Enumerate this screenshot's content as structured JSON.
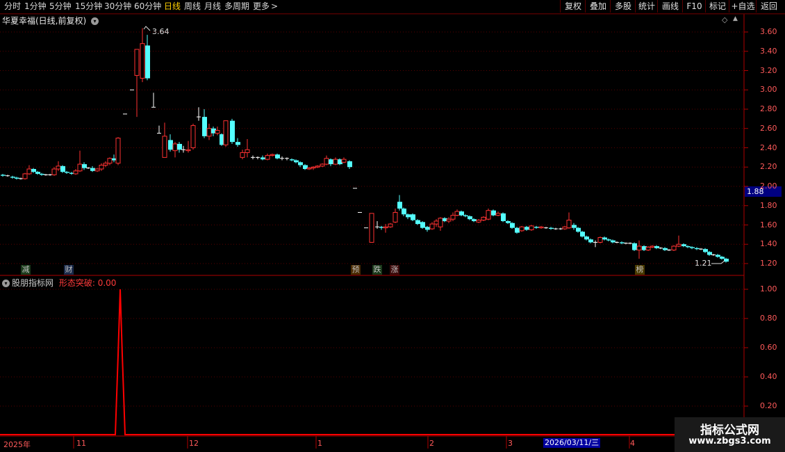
{
  "toolbar": {
    "periods": [
      "分时",
      "1分钟",
      "5分钟",
      "15分钟",
      "30分钟",
      "60分钟",
      "日线",
      "周线",
      "月线",
      "多周期",
      "更多"
    ],
    "active_period": "日线",
    "more_arrow": ">",
    "buttons": [
      "复权",
      "叠加",
      "多股",
      "统计",
      "画线",
      "F10",
      "标记",
      "+自选",
      "返回"
    ]
  },
  "main_panel": {
    "title": "华夏幸福(日线,前复权)",
    "price_axis": [
      "3.60",
      "3.40",
      "3.20",
      "3.00",
      "2.80",
      "2.60",
      "2.40",
      "2.20",
      "2.00",
      "1.80",
      "1.60",
      "1.40",
      "1.20"
    ],
    "current_price": "1.88",
    "high_label": "3.64",
    "low_label": "1.21",
    "events": [
      {
        "text": "减",
        "color": "#22cc22"
      },
      {
        "text": "财",
        "color": "#4aa0ff"
      },
      {
        "text": "预",
        "color": "#ff9a30"
      },
      {
        "text": "跌",
        "color": "#22cc22"
      },
      {
        "text": "涨",
        "color": "#ff4040"
      },
      {
        "text": "榜",
        "color": "#ffcc40"
      }
    ],
    "colors": {
      "up": "#ff3232",
      "down": "#54ffff",
      "flat": "#ffffff"
    }
  },
  "indicator_panel": {
    "source": "股朋指标网",
    "name_value": "形态突破: 0.00",
    "axis": [
      "1.00",
      "0.80",
      "0.60",
      "0.40",
      "0.20"
    ],
    "line_color": "#ff0000"
  },
  "date_axis": {
    "labels": [
      "2025年",
      "11",
      "12",
      "1",
      "2",
      "3",
      "4"
    ],
    "cursor_date": "2026/03/11/三"
  },
  "watermark": {
    "line1": "指标公式网",
    "line2": "www.zbgs3.com"
  },
  "chart_data": {
    "type": "candlestick",
    "ylim": [
      1.15,
      3.75
    ],
    "indicator": {
      "name": "形态突破",
      "ylim": [
        0,
        1.05
      ],
      "spike_value": 1.0,
      "baseline": 0.0
    }
  }
}
